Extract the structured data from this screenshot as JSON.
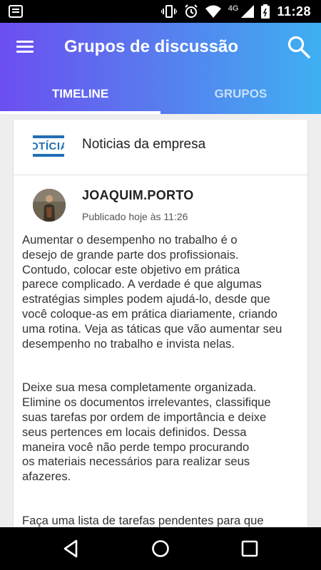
{
  "status_bar": {
    "network": "4G",
    "time": "11:28"
  },
  "app_bar": {
    "title": "Grupos de discussão"
  },
  "tabs": [
    {
      "label": "TIMELINE",
      "active": true
    },
    {
      "label": "GRUPOS",
      "active": false
    }
  ],
  "group": {
    "logo_text": "OTÍCIA",
    "name": "Noticias da empresa"
  },
  "post": {
    "author": "JOAQUIM.PORTO",
    "published": "Publicado hoje às 11:26",
    "paragraphs": [
      "Aumentar o desempenho no trabalho é o\ndesejo de grande parte dos profissionais.\nContudo, colocar este objetivo em prática\nparece complicado. A verdade é que algumas\nestratégias simples podem ajudá-lo, desde que\nvocê coloque-as em prática diariamente, criando\numa rotina. Veja as táticas que vão aumentar seu\ndesempenho no trabalho e invista nelas.",
      "Deixe sua mesa completamente organizada.\nElimine os documentos irrelevantes, classifique\nsuas tarefas por ordem de importância e deixe\nseus pertences em locais definidos. Dessa\nmaneira você não perde tempo procurando\nos materiais necessários para realizar seus\nafazeres.",
      "Faça uma lista de tarefas pendentes para que"
    ]
  },
  "colors": {
    "app_bar_gradient_start": "#6b4ff0",
    "app_bar_gradient_end": "#3fb0f2",
    "logo_blue": "#1f6fb4"
  },
  "icons": {
    "menu": "menu-icon",
    "search": "search-icon",
    "back": "back-icon",
    "home": "home-icon",
    "recent": "recent-apps-icon"
  }
}
